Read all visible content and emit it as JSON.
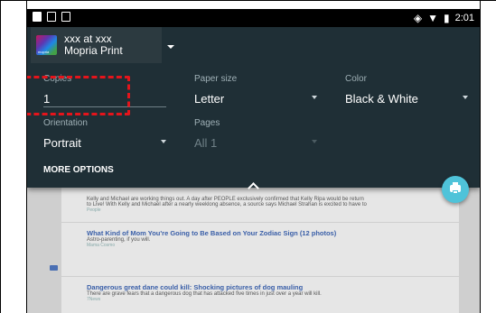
{
  "status_bar": {
    "time": "2:01"
  },
  "printer": {
    "line1": "xxx at xxx",
    "line2": "Mopria Print",
    "logo_text": "mopria"
  },
  "fields": {
    "copies": {
      "label": "Copies",
      "value": "1"
    },
    "paper_size": {
      "label": "Paper size",
      "value": "Letter"
    },
    "color": {
      "label": "Color",
      "value": "Black & White"
    },
    "orientation": {
      "label": "Orientation",
      "value": "Portrait"
    },
    "pages": {
      "label": "Pages",
      "value": "All 1"
    }
  },
  "more_options": "MORE OPTIONS",
  "colors": {
    "panel": "#1f2f36",
    "accent": "#4fc3d9",
    "highlight": "#e5141b"
  },
  "articles": [
    {
      "title": "",
      "desc": "Kelly and Michael are working things out. A day after PEOPLE exclusively confirmed that Kelly Ripa would be return",
      "desc2": "to Live! With Kelly and Michael after a nearly weeklong absence, a source says Michael Strahan is excited to have to",
      "source": "People"
    },
    {
      "title": "What Kind of Mom You're Going to Be Based on Your Zodiac Sign (12 photos)",
      "desc": "Astro-parenting, if you will.",
      "source": "Mama Cosmo"
    },
    {
      "title": "Dangerous great dane could kill: Shocking pictures of dog mauling",
      "desc": "There are grave fears that a dangerous dog that has attacked five times in just over a year will kill.",
      "source": "7News"
    }
  ]
}
